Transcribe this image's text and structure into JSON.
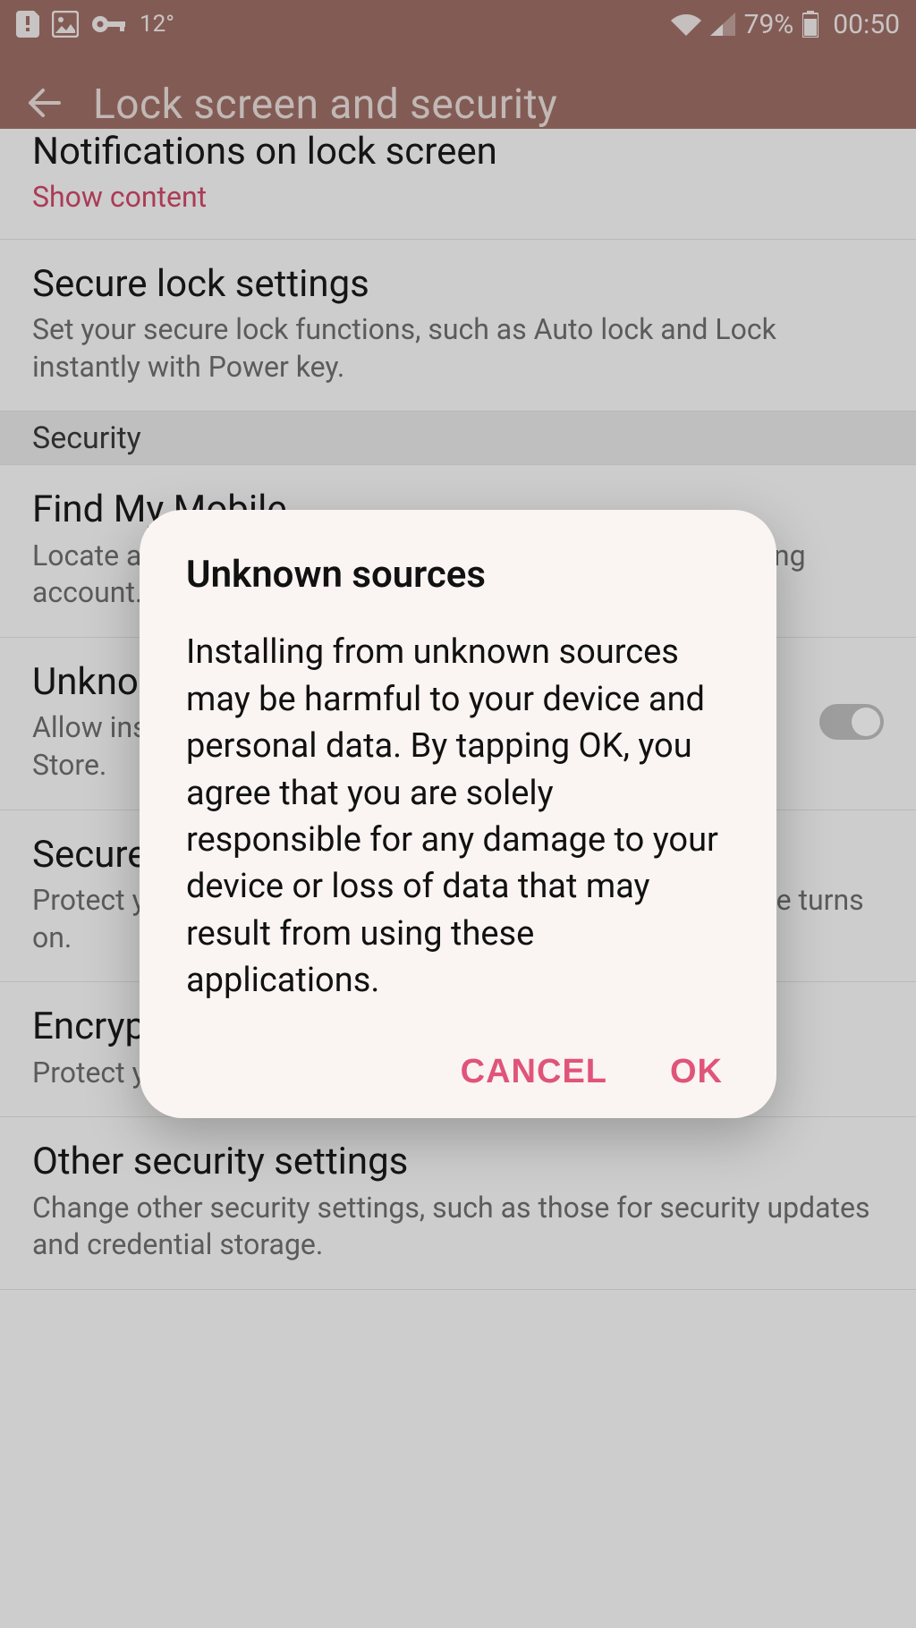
{
  "status": {
    "temperature": "12°",
    "battery_pct": "79%",
    "time": "00:50"
  },
  "appbar": {
    "title": "Lock screen and security"
  },
  "list": {
    "notifications": {
      "title": "Notifications on lock screen",
      "sub": "Show content"
    },
    "secure_lock": {
      "title": "Secure lock settings",
      "sub": "Set your secure lock functions, such as Auto lock and Lock instantly with Power key."
    },
    "section_security": "Security",
    "find_my_mobile": {
      "title": "Find My Mobile",
      "sub": "Locate and control your device remotely using your Samsung account."
    },
    "unknown_sources": {
      "title": "Unknown sources",
      "sub": "Allow installation of apps from sources other than the Play Store."
    },
    "secure_startup": {
      "title": "Secure startup",
      "sub": "Protect your device by using a screen lock when your device turns on."
    },
    "encrypt_sd": {
      "title": "Encrypt SD card",
      "sub": "Protect your SD card by encrypting its data."
    },
    "other_security": {
      "title": "Other security settings",
      "sub": "Change other security settings, such as those for security updates and credential storage."
    }
  },
  "dialog": {
    "title": "Unknown sources",
    "body": "Installing from unknown sources may be harmful to your device and personal data. By tapping OK, you agree that you are solely responsible for any damage to your device or loss of data that may result from using these applications.",
    "cancel": "CANCEL",
    "ok": "OK"
  }
}
